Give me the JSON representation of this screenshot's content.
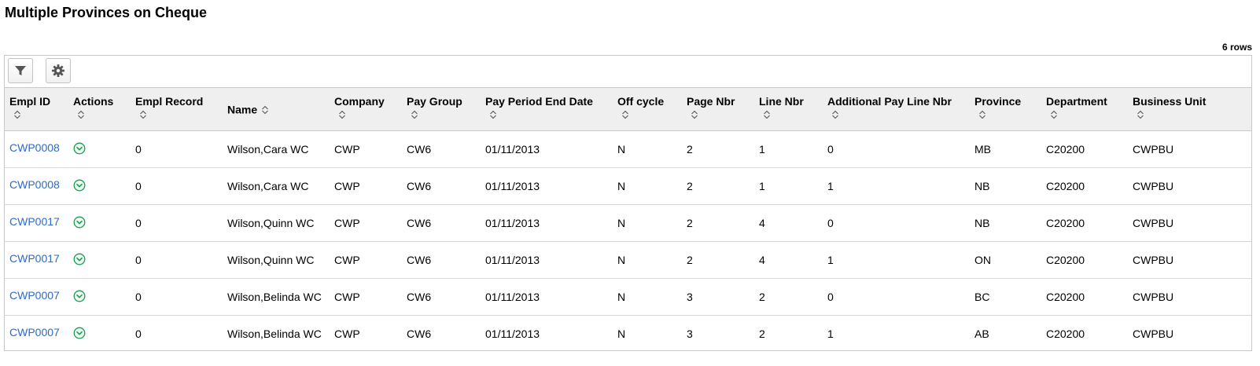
{
  "page": {
    "title": "Multiple Provinces on Cheque",
    "row_count": "6 rows"
  },
  "toolbar": {
    "filter_icon": "filter-icon",
    "settings_icon": "gear-icon"
  },
  "colors": {
    "link": "#2c6bc5",
    "action_icon": "#1f9a55",
    "header_bg": "#efefef",
    "border": "#c8c8c8"
  },
  "grid": {
    "columns": [
      {
        "key": "empl_id",
        "label": "Empl ID"
      },
      {
        "key": "actions",
        "label": "Actions"
      },
      {
        "key": "empl_record",
        "label": "Empl Record"
      },
      {
        "key": "name",
        "label": "Name"
      },
      {
        "key": "company",
        "label": "Company"
      },
      {
        "key": "pay_group",
        "label": "Pay Group"
      },
      {
        "key": "pay_period_end_date",
        "label": "Pay Period End Date"
      },
      {
        "key": "off_cycle",
        "label": "Off cycle"
      },
      {
        "key": "page_nbr",
        "label": "Page Nbr"
      },
      {
        "key": "line_nbr",
        "label": "Line Nbr"
      },
      {
        "key": "additional_pay_line_nbr",
        "label": "Additional Pay Line Nbr"
      },
      {
        "key": "province",
        "label": "Province"
      },
      {
        "key": "department",
        "label": "Department"
      },
      {
        "key": "business_unit",
        "label": "Business Unit"
      }
    ],
    "rows": [
      {
        "empl_id": "CWP0008",
        "empl_record": "0",
        "name": "Wilson,Cara WC",
        "company": "CWP",
        "pay_group": "CW6",
        "pay_period_end_date": "01/11/2013",
        "off_cycle": "N",
        "page_nbr": "2",
        "line_nbr": "1",
        "additional_pay_line_nbr": "0",
        "province": "MB",
        "department": "C20200",
        "business_unit": "CWPBU"
      },
      {
        "empl_id": "CWP0008",
        "empl_record": "0",
        "name": "Wilson,Cara WC",
        "company": "CWP",
        "pay_group": "CW6",
        "pay_period_end_date": "01/11/2013",
        "off_cycle": "N",
        "page_nbr": "2",
        "line_nbr": "1",
        "additional_pay_line_nbr": "1",
        "province": "NB",
        "department": "C20200",
        "business_unit": "CWPBU"
      },
      {
        "empl_id": "CWP0017",
        "empl_record": "0",
        "name": "Wilson,Quinn WC",
        "company": "CWP",
        "pay_group": "CW6",
        "pay_period_end_date": "01/11/2013",
        "off_cycle": "N",
        "page_nbr": "2",
        "line_nbr": "4",
        "additional_pay_line_nbr": "0",
        "province": "NB",
        "department": "C20200",
        "business_unit": "CWPBU"
      },
      {
        "empl_id": "CWP0017",
        "empl_record": "0",
        "name": "Wilson,Quinn WC",
        "company": "CWP",
        "pay_group": "CW6",
        "pay_period_end_date": "01/11/2013",
        "off_cycle": "N",
        "page_nbr": "2",
        "line_nbr": "4",
        "additional_pay_line_nbr": "1",
        "province": "ON",
        "department": "C20200",
        "business_unit": "CWPBU"
      },
      {
        "empl_id": "CWP0007",
        "empl_record": "0",
        "name": "Wilson,Belinda WC",
        "company": "CWP",
        "pay_group": "CW6",
        "pay_period_end_date": "01/11/2013",
        "off_cycle": "N",
        "page_nbr": "3",
        "line_nbr": "2",
        "additional_pay_line_nbr": "0",
        "province": "BC",
        "department": "C20200",
        "business_unit": "CWPBU"
      },
      {
        "empl_id": "CWP0007",
        "empl_record": "0",
        "name": "Wilson,Belinda WC",
        "company": "CWP",
        "pay_group": "CW6",
        "pay_period_end_date": "01/11/2013",
        "off_cycle": "N",
        "page_nbr": "3",
        "line_nbr": "2",
        "additional_pay_line_nbr": "1",
        "province": "AB",
        "department": "C20200",
        "business_unit": "CWPBU"
      }
    ]
  }
}
